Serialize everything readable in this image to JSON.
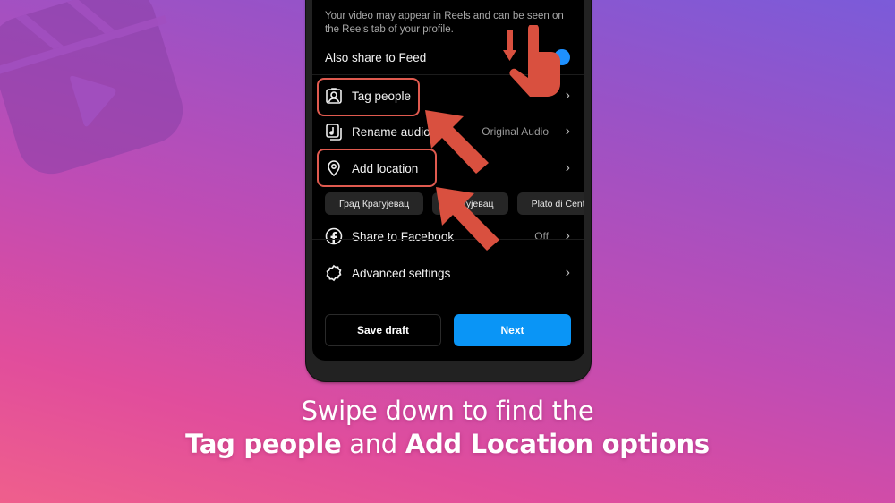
{
  "background": {
    "gradient_top": "#7b5bd9",
    "gradient_bottom": "#ef5f8c",
    "icon": "reels-logo-icon"
  },
  "phone": {
    "info_text": "Your video may appear in Reels and can be seen on the Reels tab of your profile.",
    "also_share_feed": {
      "label": "Also share to Feed",
      "toggle_on": true
    },
    "rows": [
      {
        "icon": "tag-person-icon",
        "label": "Tag people",
        "value": "",
        "chevron": "›"
      },
      {
        "icon": "music-note-icon",
        "label": "Rename audio",
        "value": "Original Audio",
        "chevron": "›"
      },
      {
        "icon": "location-pin-icon",
        "label": "Add location",
        "value": "",
        "chevron": "›"
      },
      {
        "icon": "facebook-icon",
        "label": "Share to Facebook",
        "value": "Off",
        "chevron": "›"
      },
      {
        "icon": "gear-icon",
        "label": "Advanced settings",
        "value": "",
        "chevron": "›"
      }
    ],
    "location_chips": [
      "Град Крагујевац",
      "Крагујевац",
      "Plato di Centro"
    ],
    "buttons": {
      "save_draft": "Save draft",
      "next": "Next"
    }
  },
  "colors": {
    "accent_blue": "#0a95f6",
    "highlight_red": "#e05a4f",
    "screen_bg": "#000000"
  },
  "caption": {
    "line1": "Swipe down to find the",
    "line2_bold1": "Tag people",
    "line2_mid": " and ",
    "line2_bold2": "Add Location options"
  }
}
